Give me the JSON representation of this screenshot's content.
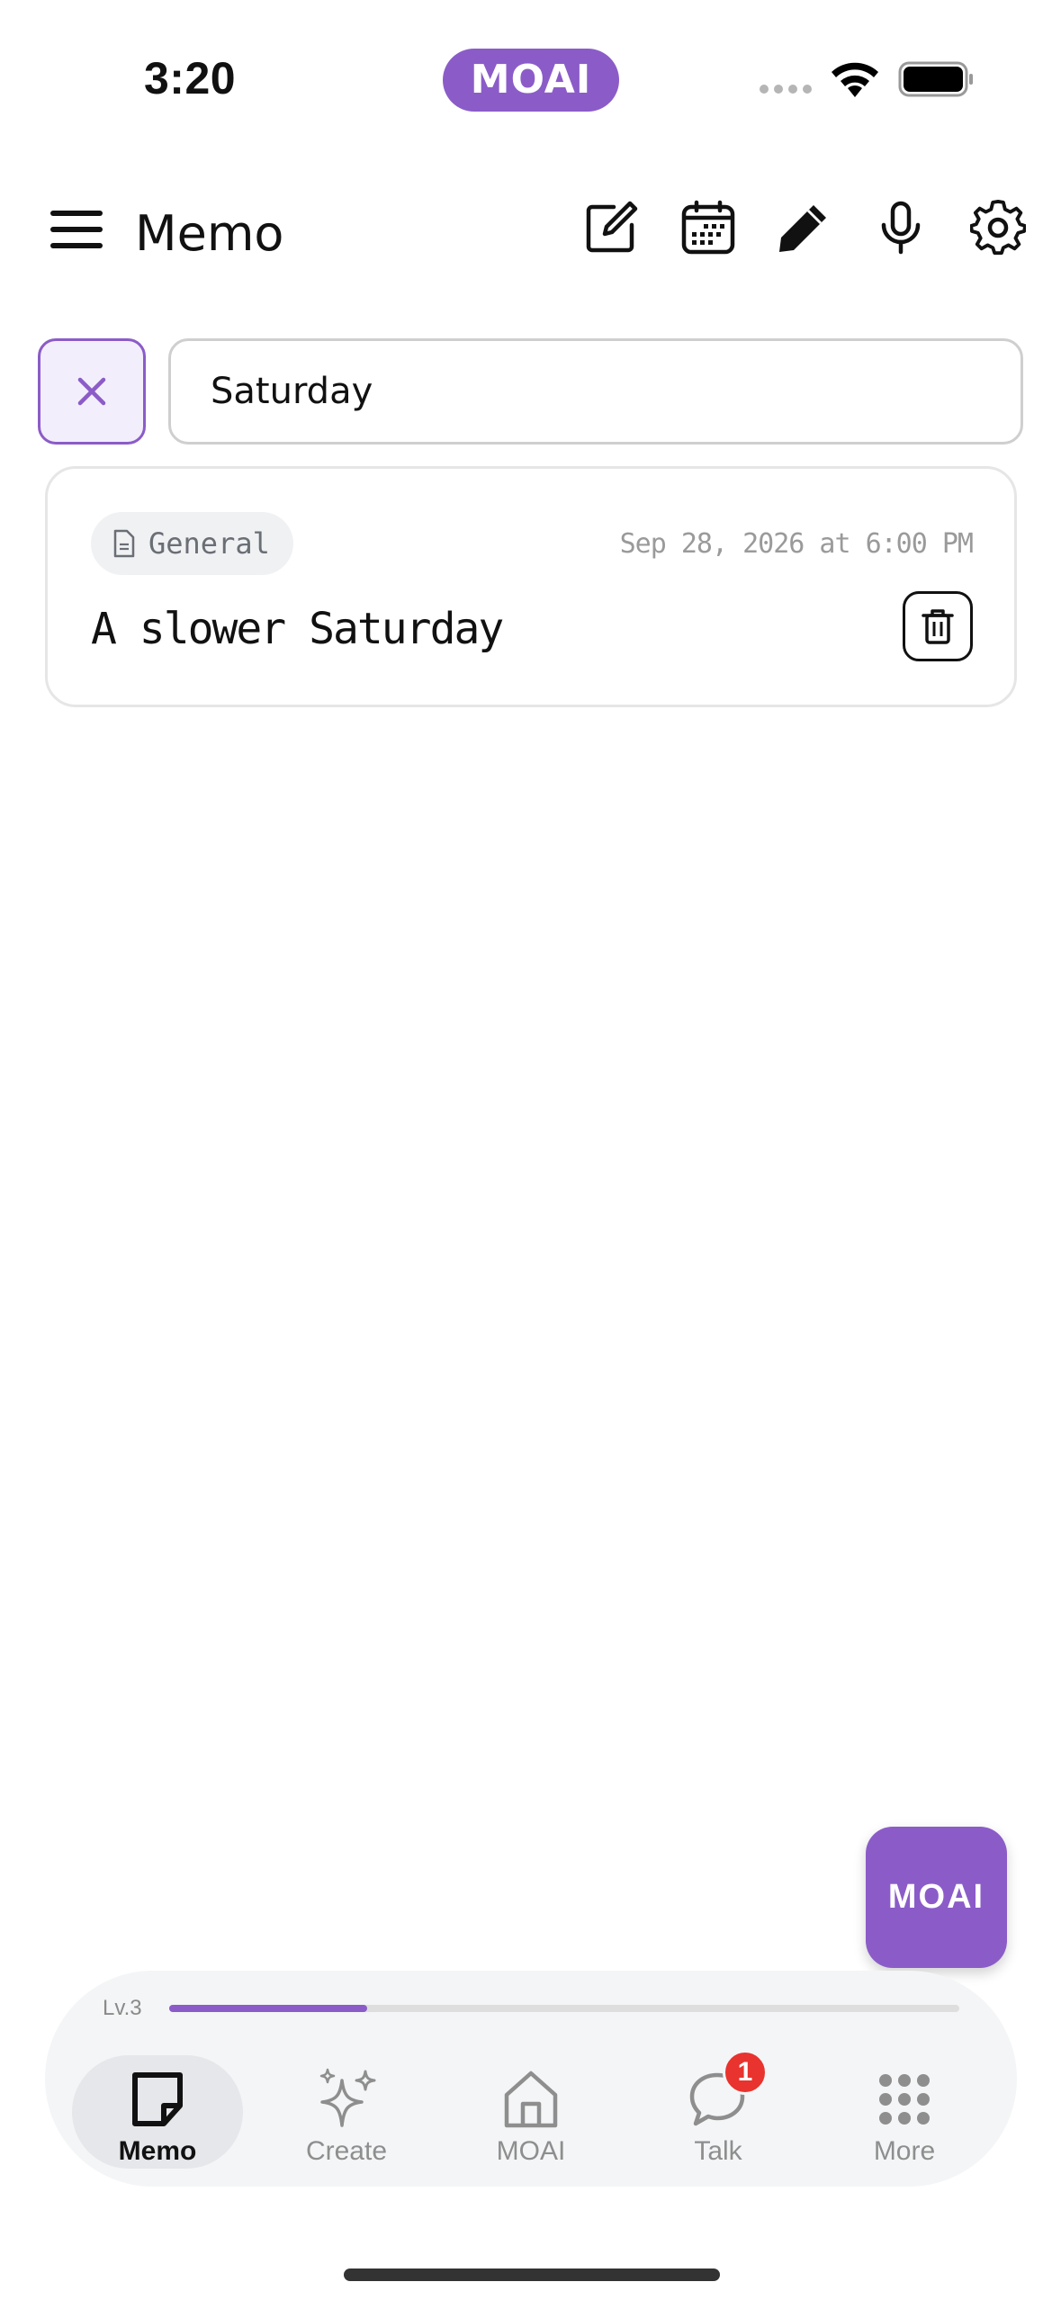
{
  "status_bar": {
    "time": "3:20",
    "app_pill": "MOAI"
  },
  "header": {
    "title": "Memo",
    "icons": [
      "menu-icon",
      "compose-icon",
      "calendar-icon",
      "pencil-icon",
      "microphone-icon",
      "settings-icon"
    ]
  },
  "search": {
    "value": "Saturday"
  },
  "memos": [
    {
      "category": "General",
      "date": "Sep 28, 2026 at 6:00 PM",
      "title": "A slower Saturday"
    }
  ],
  "fab": {
    "label": "MOAI"
  },
  "bottom_nav": {
    "level_label": "Lv.3",
    "level_progress": 0.25,
    "items": [
      {
        "label": "Memo",
        "icon": "memo-icon",
        "active": true
      },
      {
        "label": "Create",
        "icon": "sparkle-icon",
        "active": false
      },
      {
        "label": "MOAI",
        "icon": "home-icon",
        "active": false
      },
      {
        "label": "Talk",
        "icon": "chat-icon",
        "active": false,
        "badge": "1"
      },
      {
        "label": "More",
        "icon": "grid-icon",
        "active": false
      }
    ]
  },
  "colors": {
    "accent": "#8b5cc8",
    "badge": "#e8332e"
  }
}
